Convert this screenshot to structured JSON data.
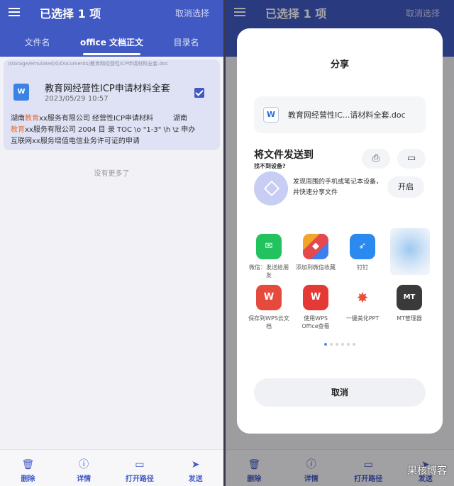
{
  "left": {
    "title": "已选择 1 项",
    "cancel_select": "取消选择",
    "tabs": [
      "文件名",
      "office 文档正文",
      "目录名"
    ],
    "path": "/storage/emulated/0/Documents/教育网经营性ICP申请材料全套.doc",
    "file_name": "教育网经营性ICP申请材料全套",
    "file_date": "2023/05/29  10:57",
    "snippet": {
      "line1_a": "湖南",
      "line1_hl": "教育",
      "line1_b": "xx服务有限公司 经营性ICP申请材料",
      "line1_c": "湖南",
      "line2_hl": "教育",
      "line2_b": "xx服务有限公司 2004   目 录 TOC \\o \"1-3\" \\h \\z  申办",
      "line3": "互联网xx服务增值电信业务许可证的申请"
    },
    "no_more": "没有更多了",
    "bottom": [
      "删除",
      "详情",
      "打开路径",
      "发送"
    ]
  },
  "right": {
    "title": "已选择 1 项",
    "cancel_select": "取消选择",
    "share_title": "分享",
    "file_name": "教育网经营性IC...请材料全套.doc",
    "send_title": "将文件发送到",
    "no_device": "找不到设备?",
    "discover_text": "发现周围的手机或笔记本设备，并快速分享文件",
    "open_button": "开启",
    "apps": [
      {
        "label": "微信：发送给朋友",
        "icon": "wechat-icon",
        "color": "#22c25f"
      },
      {
        "label": "添加到微信收藏",
        "icon": "cube-icon",
        "color": "#f2a52b"
      },
      {
        "label": "钉钉",
        "icon": "dingtalk-icon",
        "color": "#2a8af0"
      },
      {
        "label": "保存到WPS云文档",
        "icon": "wps-cloud-icon",
        "color": "#e64a3d"
      },
      {
        "label": "使用WPS Office查看",
        "icon": "wps-office-icon",
        "color": "#e53935"
      },
      {
        "label": "一键美化PPT",
        "icon": "ppt-beautify-icon",
        "color": "#f04c3b"
      },
      {
        "label": "MT管理器",
        "icon": "mt-manager-icon",
        "color": "#3a3a3a"
      }
    ],
    "cancel_button": "取消",
    "bottom": [
      "删除",
      "详情",
      "打开路径",
      "发送"
    ],
    "watermark": "果核博客"
  }
}
